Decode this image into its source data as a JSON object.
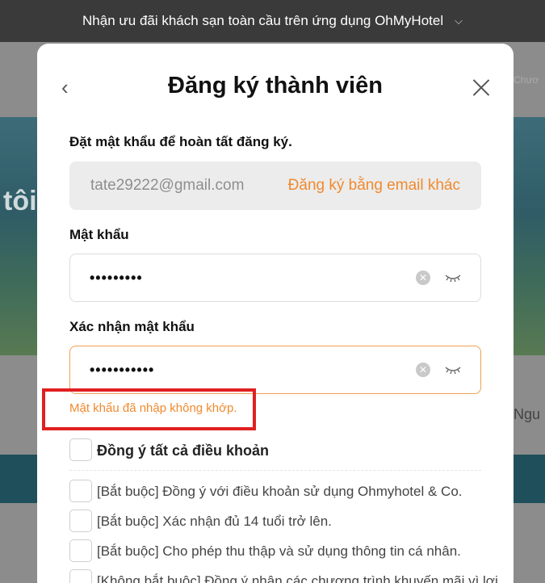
{
  "banner": {
    "text": "Nhận ưu đãi khách sạn toàn cầu trên ứng dụng OhMyHotel",
    "chevron": "⌵"
  },
  "background": {
    "left_text": "tôi",
    "right_text": "Chươ",
    "right_text2": "Ngu"
  },
  "modal": {
    "title": "Đăng ký thành viên",
    "subtitle": "Đặt mật khẩu để hoàn tất đăng ký.",
    "email_value": "tate29222@gmail.com",
    "email_change_link": "Đăng ký bằng email khác",
    "password_label": "Mật khẩu",
    "password_value": "•••••••••",
    "confirm_label": "Xác nhận mật khẩu",
    "confirm_value": "•••••••••••",
    "error_text": "Mật khẩu đã nhập không khớp.",
    "agree_all": "Đồng ý tất cả điều khoản",
    "terms": [
      "[Bắt buộc] Đồng ý với điều khoản sử dụng Ohmyhotel & Co.",
      "[Bắt buộc] Xác nhận đủ 14 tuổi trở lên.",
      "[Bắt buộc] Cho phép thu thập và sử dụng thông tin cá nhân.",
      "[Không bắt buộc] Đồng ý nhận các chương trình khuyến mãi vì lợi"
    ]
  },
  "colors": {
    "accent": "#f08a2e",
    "highlight": "#e02020"
  }
}
